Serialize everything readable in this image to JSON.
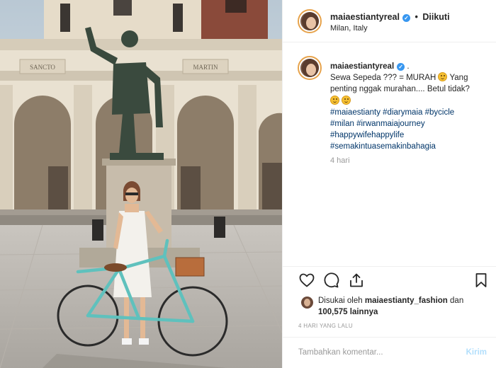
{
  "post": {
    "username": "maiaestiantyreal",
    "follow_separator": "•",
    "follow_label": "Diikuti",
    "location": "Milan, Italy"
  },
  "photo": {
    "inscriptions": [
      "SANCTO",
      "MARTIN"
    ]
  },
  "caption": {
    "username": "maiaestiantyreal",
    "after_username": ".",
    "line1": "Sewa Sepeda ??? = MURAH",
    "line1_after": "Yang penting nggak murahan.... Betul tidak?",
    "hashtags": [
      "#maiaestianty #diarymaia #bycicle",
      "#milan #irwanmaiajourney",
      "#happywifehappylife",
      "#semakintuasemakinbahagia"
    ],
    "time": "4 hari"
  },
  "icons": {
    "like": "heart-icon",
    "comment": "comment-icon",
    "share": "share-icon",
    "save": "bookmark-icon",
    "verified": "verified-badge-icon",
    "emoji": "grinning-face-emoji"
  },
  "likes": {
    "prefix": "Disukai oleh",
    "liked_by": "maiaestianty_fashion",
    "conjunction": "dan",
    "count": "100,575 lainnya"
  },
  "timestamp_caps": "4 HARI YANG LALU",
  "comment": {
    "placeholder": "Tambahkan komentar...",
    "post_label": "Kirim"
  },
  "colors": {
    "link": "#003569",
    "verified": "#3897f0",
    "post_button": "#b2dffc",
    "story_ring": "#e7a34c"
  }
}
